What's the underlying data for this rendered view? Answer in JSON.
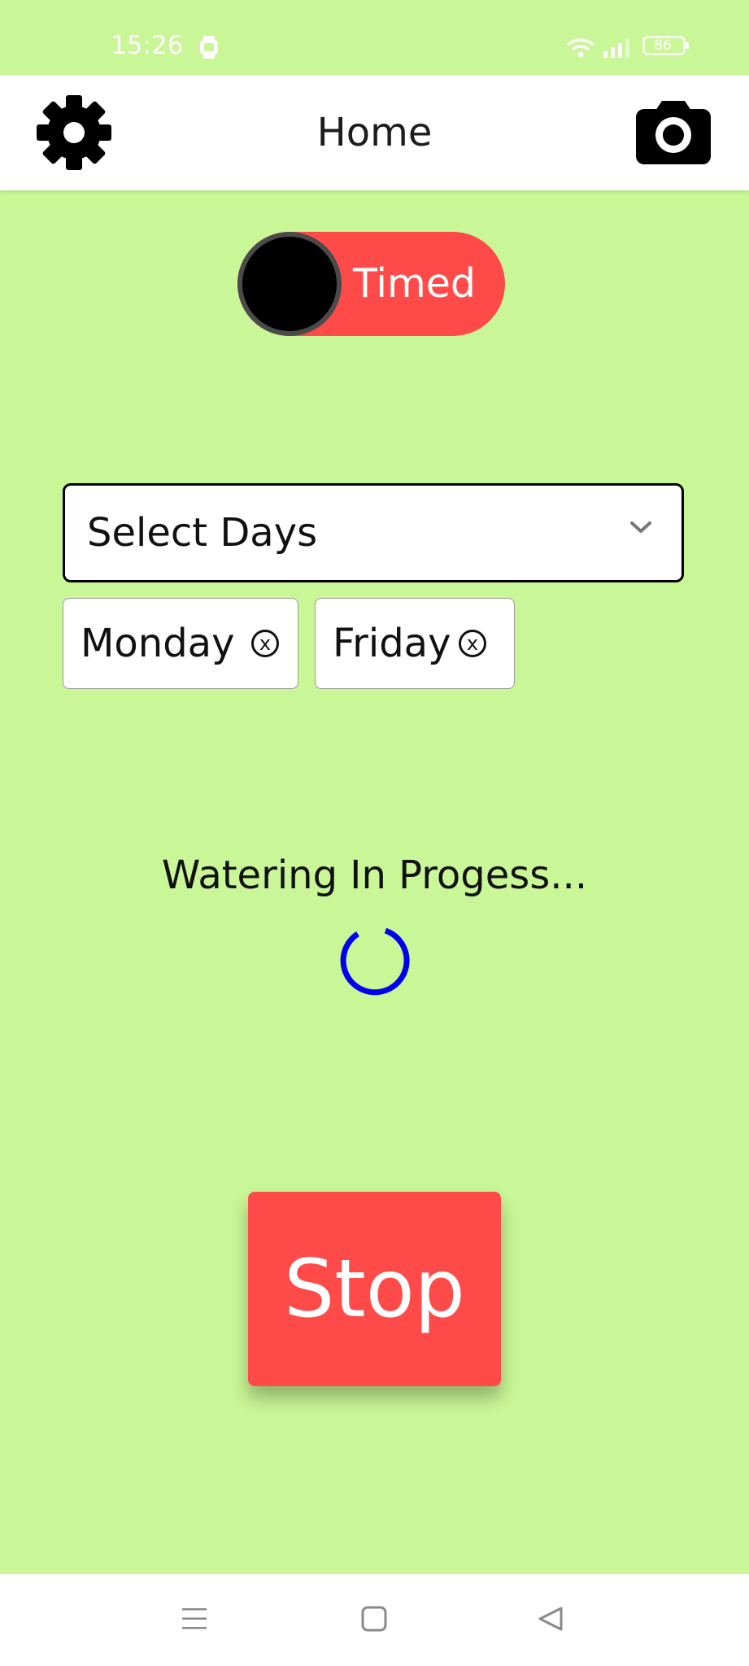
{
  "status_bar": {
    "time": "15:26",
    "battery": "86",
    "icons": [
      "watch-icon",
      "wifi-icon",
      "signal-icon",
      "battery-icon"
    ]
  },
  "app_bar": {
    "title": "Home",
    "left_icon": "gear-icon",
    "right_icon": "camera-icon"
  },
  "mode_toggle": {
    "label": "Timed",
    "color": "#ff4a4a"
  },
  "days_select": {
    "placeholder": "Select Days",
    "icon": "chevron-down-icon",
    "selected": [
      {
        "label": "Monday",
        "remove": "x"
      },
      {
        "label": "Friday",
        "remove": "x"
      }
    ]
  },
  "status": {
    "text": "Watering In Progess...",
    "spinner_color": "#0000ee"
  },
  "stop_button": {
    "label": "Stop",
    "color": "#ff4a4a"
  },
  "nav_bar": {
    "icons": [
      "menu-icon",
      "home-icon",
      "back-icon"
    ]
  },
  "colors": {
    "background": "#c9f696",
    "accent": "#ff4a4a"
  }
}
